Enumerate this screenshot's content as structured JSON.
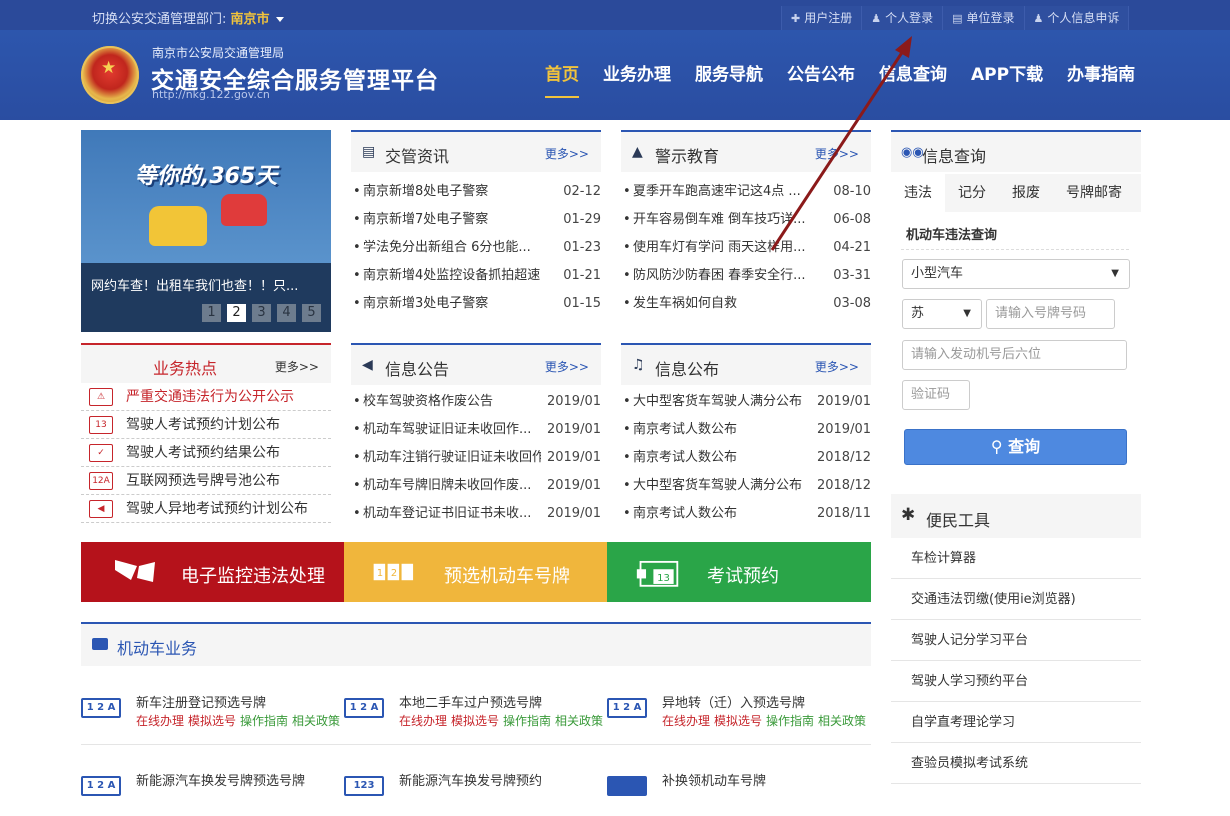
{
  "topbar": {
    "dept_label": "切换公安交通管理部门:",
    "dept_city": "南京市",
    "links": [
      {
        "icon": "plus-icon",
        "label": "用户注册"
      },
      {
        "icon": "user-icon",
        "label": "个人登录"
      },
      {
        "icon": "building-icon",
        "label": "单位登录"
      },
      {
        "icon": "user-icon",
        "label": "个人信息申诉"
      }
    ]
  },
  "header": {
    "subtitle": "南京市公安局交通管理局",
    "title": "交通安全综合服务管理平台",
    "url": "http://nkg.122.gov.cn",
    "nav": [
      "首页",
      "业务办理",
      "服务导航",
      "公告公布",
      "信息查询",
      "APP下载",
      "办事指南"
    ]
  },
  "banner": {
    "slogan": "等你的,365天",
    "caption": "网约车查！出租车我们也查！！只...",
    "pages": [
      "1",
      "2",
      "3",
      "4",
      "5"
    ]
  },
  "traffic_news": {
    "title": "交管资讯",
    "more": "更多>>",
    "items": [
      {
        "text": "南京新增8处电子警察",
        "date": "02-12"
      },
      {
        "text": "南京新增7处电子警察",
        "date": "01-29"
      },
      {
        "text": "学法免分出新组合 6分也能...",
        "date": "01-23"
      },
      {
        "text": "南京新增4处监控设备抓拍超速",
        "date": "01-21"
      },
      {
        "text": "南京新增3处电子警察",
        "date": "01-15"
      }
    ]
  },
  "warning_edu": {
    "title": "警示教育",
    "more": "更多>>",
    "items": [
      {
        "text": "夏季开车跑高速牢记这4点 ...",
        "date": "08-10"
      },
      {
        "text": "开车容易倒车难 倒车技巧详...",
        "date": "06-08"
      },
      {
        "text": "使用车灯有学问 雨天这样用...",
        "date": "04-21"
      },
      {
        "text": "防风防沙防春困 春季安全行...",
        "date": "03-31"
      },
      {
        "text": "发生车祸如何自救",
        "date": "03-08"
      }
    ]
  },
  "hot": {
    "title": "业务热点",
    "more": "更多>>",
    "items": [
      {
        "label": "严重交通违法行为公开公示",
        "icon": "warning-sign-icon"
      },
      {
        "label": "驾驶人考试预约计划公布",
        "icon": "calendar-icon"
      },
      {
        "label": "驾驶人考试预约结果公布",
        "icon": "calendar-check-icon"
      },
      {
        "label": "互联网预选号牌号池公布",
        "icon": "plate-icon"
      },
      {
        "label": "驾驶人异地考试预约计划公布",
        "icon": "megaphone-icon"
      }
    ]
  },
  "info_notice": {
    "title": "信息公告",
    "more": "更多>>",
    "items": [
      {
        "text": "校车驾驶资格作废公告",
        "date": "2019/01"
      },
      {
        "text": "机动车驾驶证旧证未收回作...",
        "date": "2019/01"
      },
      {
        "text": "机动车注销行驶证旧证未收回作...",
        "date": "2019/01"
      },
      {
        "text": "机动车号牌旧牌未收回作废...",
        "date": "2019/01"
      },
      {
        "text": "机动车登记证书旧证书未收...",
        "date": "2019/01"
      }
    ]
  },
  "info_publish": {
    "title": "信息公布",
    "more": "更多>>",
    "items": [
      {
        "text": "大中型客货车驾驶人满分公布",
        "date": "2019/01"
      },
      {
        "text": "南京考试人数公布",
        "date": "2019/01"
      },
      {
        "text": "南京考试人数公布",
        "date": "2018/12"
      },
      {
        "text": "大中型客货车驾驶人满分公布",
        "date": "2018/12"
      },
      {
        "text": "南京考试人数公布",
        "date": "2018/11"
      }
    ]
  },
  "big_buttons": [
    {
      "label": "电子监控违法处理",
      "color": "#b5121b",
      "icon": "flag-icon"
    },
    {
      "label": "预选机动车号牌",
      "color": "#f0b63c",
      "icon": "plate-number-icon"
    },
    {
      "label": "考试预约",
      "color": "#2aa548",
      "icon": "calendar-icon"
    }
  ],
  "vehicle_section": {
    "title": "机动车业务",
    "items": [
      {
        "name": "新车注册登记预选号牌",
        "plate": "1 2 A",
        "actions": [
          "在线办理",
          "模拟选号",
          "操作指南",
          "相关政策"
        ]
      },
      {
        "name": "本地二手车过户预选号牌",
        "plate": "1 2 A",
        "actions": [
          "在线办理",
          "模拟选号",
          "操作指南",
          "相关政策"
        ]
      },
      {
        "name": "异地转（迁）入预选号牌",
        "plate": "1 2 A",
        "actions": [
          "在线办理",
          "模拟选号",
          "操作指南",
          "相关政策"
        ]
      },
      {
        "name": "新能源汽车换发号牌预选号牌",
        "plate": "1 2 A",
        "actions": []
      },
      {
        "name": "新能源汽车换发号牌预约",
        "plate": "123",
        "actions": []
      },
      {
        "name": "补换领机动车号牌",
        "plate": "",
        "actions": []
      }
    ]
  },
  "query": {
    "title": "信息查询",
    "tabs": [
      "违法",
      "记分",
      "报废",
      "号牌邮寄"
    ],
    "subtitle": "机动车违法查询",
    "vehicle_type": "小型汽车",
    "province": "苏",
    "plate_placeholder": "请输入号牌号码",
    "engine_placeholder": "请输入发动机号后六位",
    "captcha_placeholder": "验证码",
    "button": "查询"
  },
  "tools": {
    "title": "便民工具",
    "items": [
      "车检计算器",
      "交通违法罚缴(使用ie浏览器)",
      "驾驶人记分学习平台",
      "驾驶人学习预约平台",
      "自学直考理论学习",
      "查验员模拟考试系统"
    ]
  },
  "colors": {
    "primary": "#2b56b3",
    "header": "#2b4a9a",
    "accent": "#f1c33c",
    "red": "#c6252b",
    "arrow": "#8b1a1a"
  }
}
